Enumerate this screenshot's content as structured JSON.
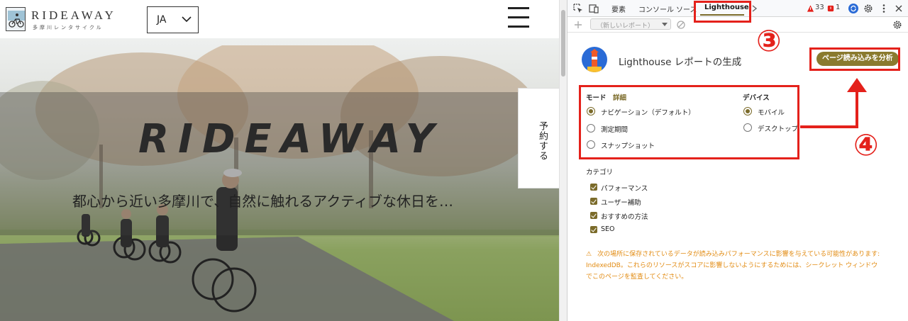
{
  "site": {
    "logo_text": "RIDEAWAY",
    "logo_sub": "多摩川レンタサイクル",
    "language": "JA",
    "hero_title": "RIDEAWAY",
    "hero_tagline": "都心から近い多摩川で、自然に触れるアクティブな休日を…",
    "reserve_label": "予約する"
  },
  "devtools": {
    "tabs": [
      "要素",
      "コンソール",
      "ソース",
      "Lighthouse"
    ],
    "active_tab": "Lighthouse",
    "warnings_count": "33",
    "errors_count": "1",
    "report_select": "（新しいレポート）",
    "lighthouse": {
      "title": "Lighthouse レポートの生成",
      "analyze_button": "ページ読み込みを分析",
      "mode_label": "モード",
      "mode_link": "詳細",
      "modes": [
        "ナビゲーション（デフォルト）",
        "測定期間",
        "スナップショット"
      ],
      "device_label": "デバイス",
      "devices": [
        "モバイル",
        "デスクトップ"
      ],
      "categories_label": "カテゴリ",
      "categories": [
        "パフォーマンス",
        "ユーザー補助",
        "おすすめの方法",
        "SEO"
      ],
      "warning_icon": "⚠",
      "warning": "次の場所に保存されているデータが読み込みパフォーマンスに影響を与えている可能性があります: IndexedDB。これらのリソースがスコアに影響しないようにするためには、シークレット ウィンドウでこのページを監査してください。"
    }
  },
  "annotations": {
    "step3": "③",
    "step4": "④"
  },
  "colors": {
    "accent": "#7b6b2a",
    "highlight": "#e4211b",
    "warning": "#e28b12"
  }
}
